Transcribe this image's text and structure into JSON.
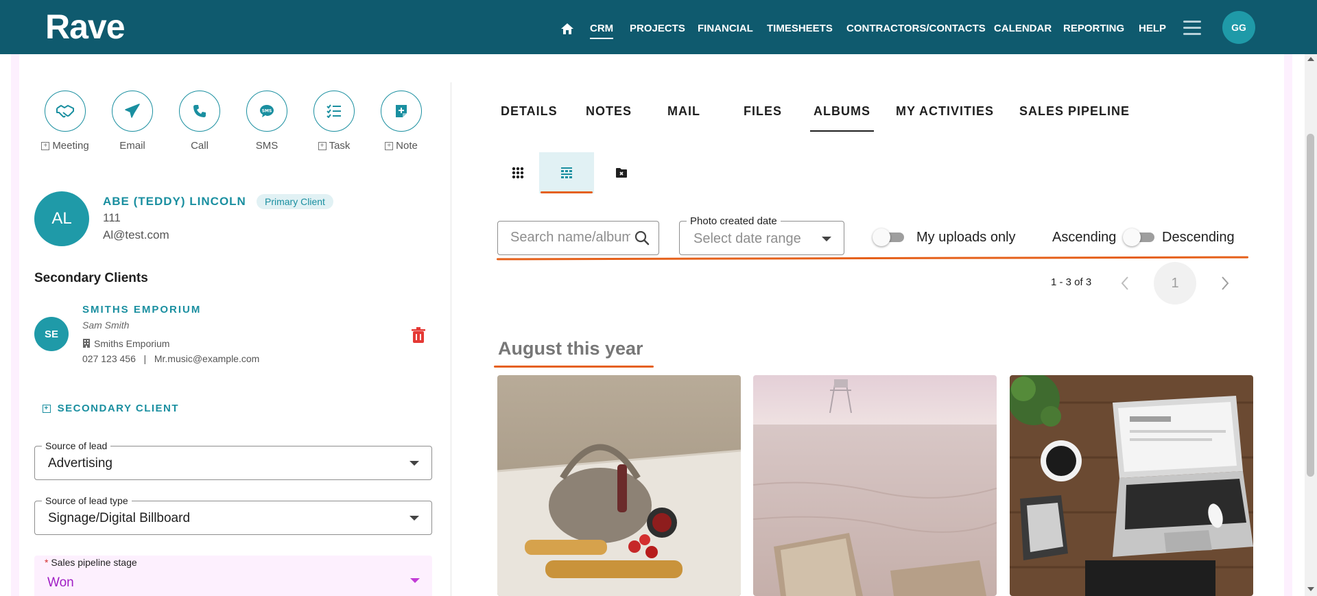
{
  "brand": {
    "logo": "Rave",
    "accent": "#1a8fa0",
    "nav_bg": "#0f5a6e",
    "highlight": "#e5601a"
  },
  "nav": {
    "items": [
      {
        "label": "CRM",
        "active": true
      },
      {
        "label": "PROJECTS"
      },
      {
        "label": "FINANCIAL"
      },
      {
        "label": "TIMESHEETS"
      },
      {
        "label": "CONTRACTORS/CONTACTS"
      },
      {
        "label": "CALENDAR"
      },
      {
        "label": "REPORTING"
      },
      {
        "label": "HELP"
      }
    ],
    "user_initials": "GG"
  },
  "actions": [
    {
      "label": "Meeting",
      "icon": "handshake-icon",
      "plus": true
    },
    {
      "label": "Email",
      "icon": "paper-plane-icon",
      "plus": false
    },
    {
      "label": "Call",
      "icon": "phone-icon",
      "plus": false
    },
    {
      "label": "SMS",
      "icon": "sms-bubble-icon",
      "plus": false
    },
    {
      "label": "Task",
      "icon": "checklist-icon",
      "plus": true
    },
    {
      "label": "Note",
      "icon": "note-plus-icon",
      "plus": true
    }
  ],
  "client": {
    "initials": "AL",
    "name": "ABE (TEDDY) LINCOLN",
    "badge": "Primary Client",
    "code": "111",
    "email": "Al@test.com"
  },
  "secondary": {
    "title": "Secondary Clients",
    "items": [
      {
        "initials": "SE",
        "name": "SMITHS EMPORIUM",
        "person": "Sam Smith",
        "company": "Smiths Emporium",
        "phone": "027 123 456",
        "separator": "|",
        "email": "Mr.music@example.com"
      }
    ],
    "add_label": "SECONDARY CLIENT"
  },
  "fields": {
    "source_of_lead": {
      "label": "Source of lead",
      "value": "Advertising"
    },
    "source_of_lead_type": {
      "label": "Source of lead type",
      "value": "Signage/Digital Billboard"
    },
    "sales_pipeline_stage": {
      "required_mark": "*",
      "label": "Sales pipeline stage",
      "value": "Won"
    }
  },
  "tabs": [
    {
      "label": "DETAILS"
    },
    {
      "label": "NOTES"
    },
    {
      "label": "MAIL"
    },
    {
      "label": "FILES"
    },
    {
      "label": "ALBUMS",
      "active": true
    },
    {
      "label": "MY ACTIVITIES"
    },
    {
      "label": "SALES PIPELINE"
    }
  ],
  "filters": {
    "search_placeholder": "Search name/album",
    "date_label": "Photo created date",
    "date_placeholder": "Select date range",
    "my_uploads_label": "My uploads only",
    "my_uploads_on": false,
    "ascending_label": "Ascending",
    "descending_label": "Descending"
  },
  "pagination": {
    "info": "1 - 3 of 3",
    "current": "1"
  },
  "album": {
    "title": "August this year"
  }
}
